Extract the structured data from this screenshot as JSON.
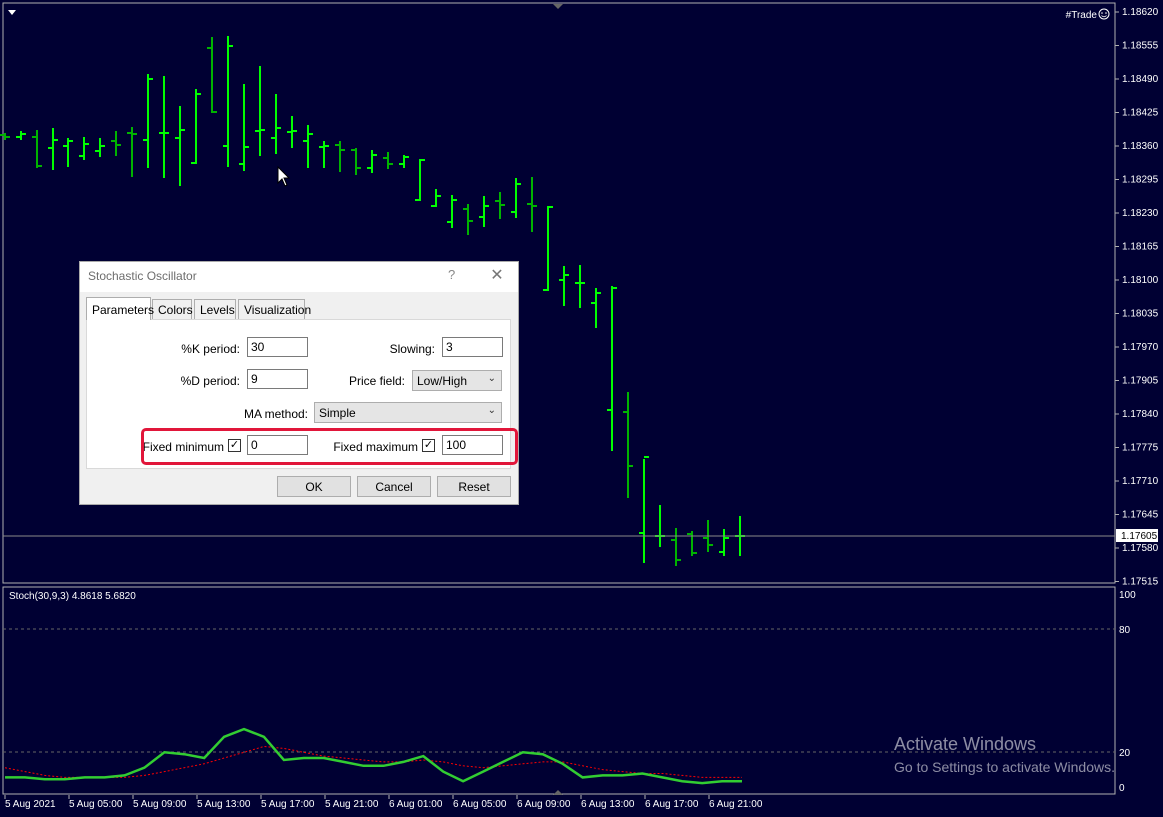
{
  "chart": {
    "symbol_label": "#Trade",
    "current_price": "1.17605",
    "price_ticks": [
      "1.18620",
      "1.18555",
      "1.18490",
      "1.18425",
      "1.18360",
      "1.18295",
      "1.18230",
      "1.18165",
      "1.18100",
      "1.18035",
      "1.17970",
      "1.17905",
      "1.17840",
      "1.17775",
      "1.17710",
      "1.17645",
      "1.17580",
      "1.17515"
    ],
    "time_ticks": [
      "5 Aug 2021",
      "5 Aug 05:00",
      "5 Aug 09:00",
      "5 Aug 13:00",
      "5 Aug 17:00",
      "5 Aug 21:00",
      "6 Aug 01:00",
      "6 Aug 05:00",
      "6 Aug 09:00",
      "6 Aug 13:00",
      "6 Aug 17:00",
      "6 Aug 21:00"
    ],
    "colors": {
      "background": "#000033",
      "bull_bar": "#00ff00",
      "bear_bar": "#00b300",
      "stoch_main": "#32cd32",
      "stoch_signal": "#ff0000"
    }
  },
  "chart_data": {
    "type": "line",
    "title": "Stoch(30,9,3) 4.8618 5.6820",
    "ylim": [
      0,
      100
    ],
    "levels": [
      20,
      80
    ],
    "y_ticks": [
      "100",
      "80",
      "20",
      "0"
    ],
    "series": [
      {
        "name": "main",
        "values": [
          5,
          5,
          4,
          4,
          5,
          5,
          6,
          10,
          18,
          17,
          15,
          26,
          30,
          26,
          14,
          15,
          15,
          13,
          11,
          11,
          13,
          16,
          8,
          3,
          8,
          13,
          18,
          17,
          12,
          5,
          6,
          6,
          7,
          5,
          3,
          2,
          3,
          3
        ]
      },
      {
        "name": "signal",
        "values": [
          10,
          8,
          6,
          5,
          5,
          5,
          5,
          6,
          8,
          10,
          12,
          15,
          18,
          21,
          20,
          18,
          16,
          15,
          14,
          13,
          13,
          14,
          13,
          11,
          10,
          11,
          12,
          13,
          13,
          11,
          9,
          8,
          7,
          7,
          6,
          5,
          5,
          5
        ]
      }
    ]
  },
  "dialog": {
    "title": "Stochastic Oscillator",
    "help": "?",
    "close": "✕",
    "tabs": [
      "Parameters",
      "Colors",
      "Levels",
      "Visualization"
    ],
    "k_period_label": "%K period:",
    "k_period_value": "30",
    "d_period_label": "%D period:",
    "d_period_value": "9",
    "slowing_label": "Slowing:",
    "slowing_value": "3",
    "price_field_label": "Price field:",
    "price_field_value": "Low/High",
    "ma_method_label": "MA method:",
    "ma_method_value": "Simple",
    "fixed_min_label": "Fixed minimum",
    "fixed_min_checked": "✓",
    "fixed_min_value": "0",
    "fixed_max_label": "Fixed maximum",
    "fixed_max_checked": "✓",
    "fixed_max_value": "100",
    "ok": "OK",
    "cancel": "Cancel",
    "reset": "Reset"
  },
  "watermark": {
    "line1": "Activate Windows",
    "line2": "Go to Settings to activate Windows."
  },
  "icons": {
    "menu": "triangle-down-icon",
    "smiley": "smiley-icon",
    "cursor": "mouse-pointer-icon"
  }
}
